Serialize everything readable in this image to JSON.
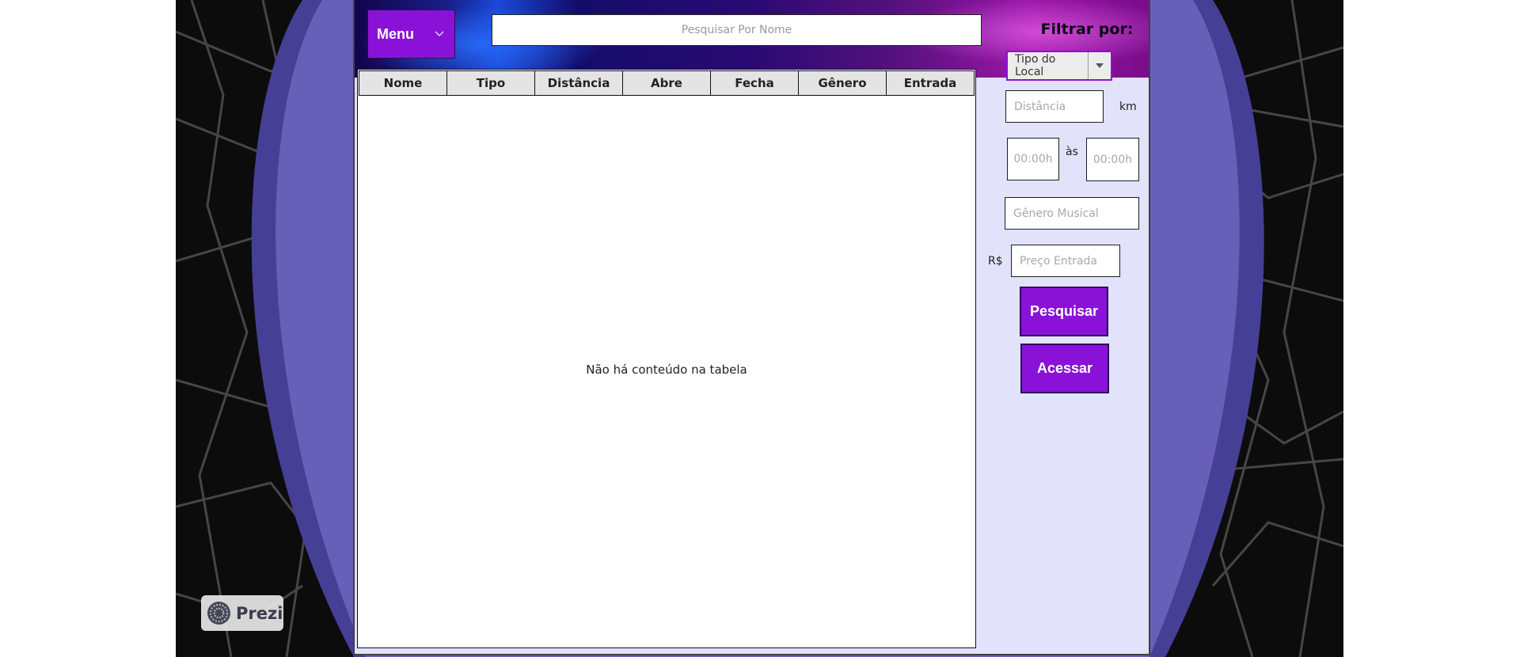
{
  "header": {
    "menu_label": "Menu",
    "search_placeholder": "Pesquisar Por Nome",
    "filter_label": "Filtrar por:",
    "type_select_value": "Tipo do Local"
  },
  "table": {
    "columns": [
      "Nome",
      "Tipo",
      "Distância",
      "Abre",
      "Fecha",
      "Gênero",
      "Entrada"
    ],
    "empty_message": "Não há conteúdo na tabela"
  },
  "filters": {
    "distance_placeholder": "Distância",
    "distance_unit": "km",
    "time_from_placeholder": "00:00h",
    "time_separator": "às",
    "time_to_placeholder": "00:00h",
    "genre_placeholder": "Gênero Musical",
    "price_prefix": "R$",
    "price_placeholder": "Preço Entrada"
  },
  "actions": {
    "search_label": "Pesquisar",
    "access_label": "Acessar"
  },
  "badge": {
    "text": "Prezi"
  },
  "colors": {
    "accent_purple": "#8a12d8",
    "panel_bg": "#e2e2fb",
    "slide_purple": "#6860b8",
    "slide_purple_dark": "#463f96",
    "map_bg": "#0c0c0c"
  }
}
